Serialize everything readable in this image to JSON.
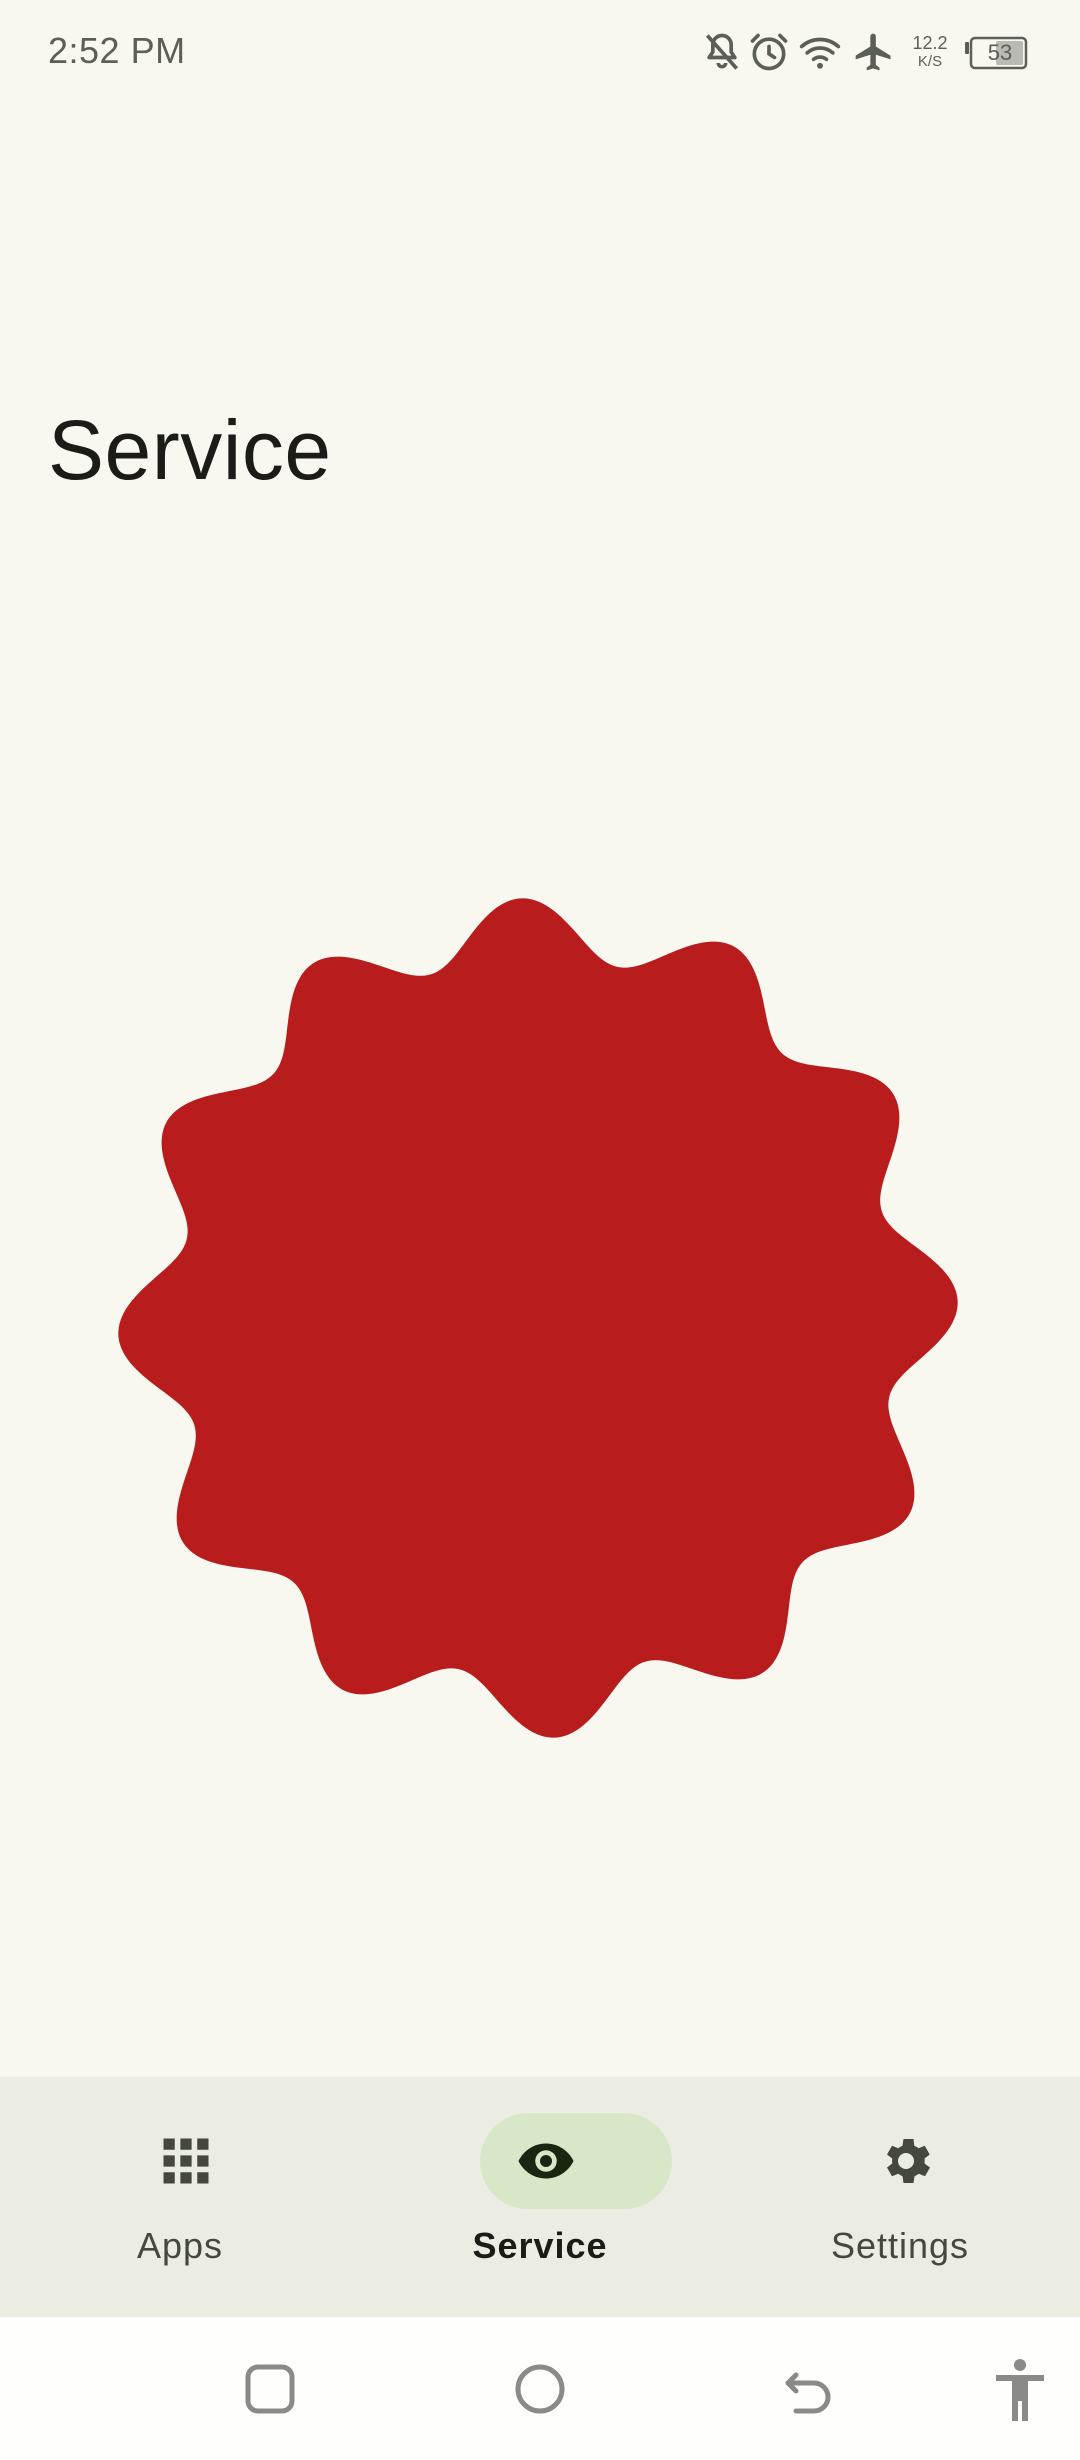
{
  "status_bar": {
    "time": "2:52 PM",
    "net_speed_value": "12.2",
    "net_speed_unit": "K/S",
    "battery_level": "53",
    "icons": [
      "notifications-off-icon",
      "alarm-icon",
      "wifi-icon",
      "airplane-mode-icon",
      "battery-icon"
    ]
  },
  "page": {
    "title": "Service"
  },
  "service_indicator": {
    "state_color": "#b81c1c",
    "shape": "wavy-badge"
  },
  "bottom_nav": {
    "items": [
      {
        "label": "Apps",
        "icon": "apps-grid-icon",
        "active": false
      },
      {
        "label": "Service",
        "icon": "eye-icon",
        "active": true
      },
      {
        "label": "Settings",
        "icon": "gear-icon",
        "active": false
      }
    ]
  },
  "system_nav": {
    "buttons": [
      "recents-button",
      "home-button",
      "back-button",
      "accessibility-button"
    ]
  },
  "colors": {
    "background": "#f8f8f0",
    "nav_background": "#ecede2",
    "active_pill": "#d9e7c9",
    "indicator": "#b81c1c"
  }
}
